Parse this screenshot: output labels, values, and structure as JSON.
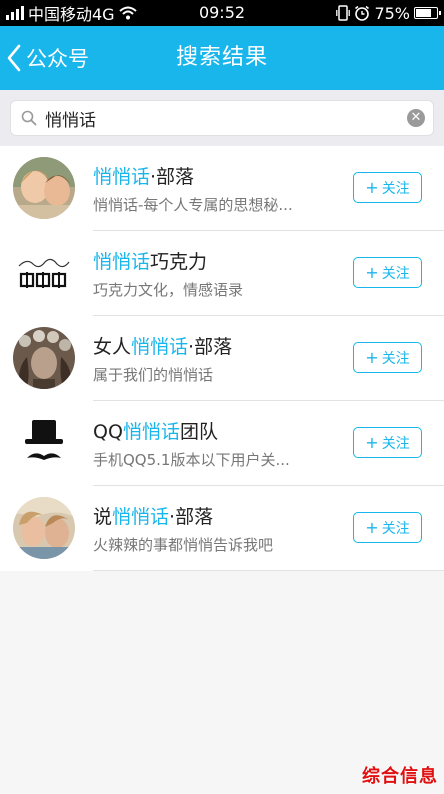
{
  "status_bar": {
    "carrier": "中国移动4G",
    "time": "09:52",
    "battery": "75%",
    "battery_level": 0.75
  },
  "navbar": {
    "back_label": "公众号",
    "title": "搜索结果"
  },
  "search": {
    "value": "悄悄话",
    "clear_icon": "clear-icon"
  },
  "colors": {
    "accent": "#19b6ec",
    "watermark": "#e01010"
  },
  "follow_label": "关注",
  "results": [
    {
      "name_pre": "",
      "name_hl": "悄悄话",
      "name_post": "·部落",
      "desc": "悄悄话-每个人专属的思想秘...",
      "avatar": "girls-whisper-photo"
    },
    {
      "name_pre": "",
      "name_hl": "悄悄话",
      "name_post": "巧克力",
      "desc": "巧克力文化，情感语录",
      "avatar": "qiaoqiaohua-logo"
    },
    {
      "name_pre": "女人",
      "name_hl": "悄悄话",
      "name_post": "·部落",
      "desc": "属于我们的悄悄话",
      "avatar": "woman-flowers-photo"
    },
    {
      "name_pre": "QQ",
      "name_hl": "悄悄话",
      "name_post": "团队",
      "desc": "手机QQ5.1版本以下用户关...",
      "avatar": "top-hat-mustache-icon"
    },
    {
      "name_pre": "说",
      "name_hl": "悄悄话",
      "name_post": "·部落",
      "desc": "火辣辣的事都悄悄告诉我吧",
      "avatar": "two-girls-photo"
    }
  ],
  "watermark": "综合信息"
}
